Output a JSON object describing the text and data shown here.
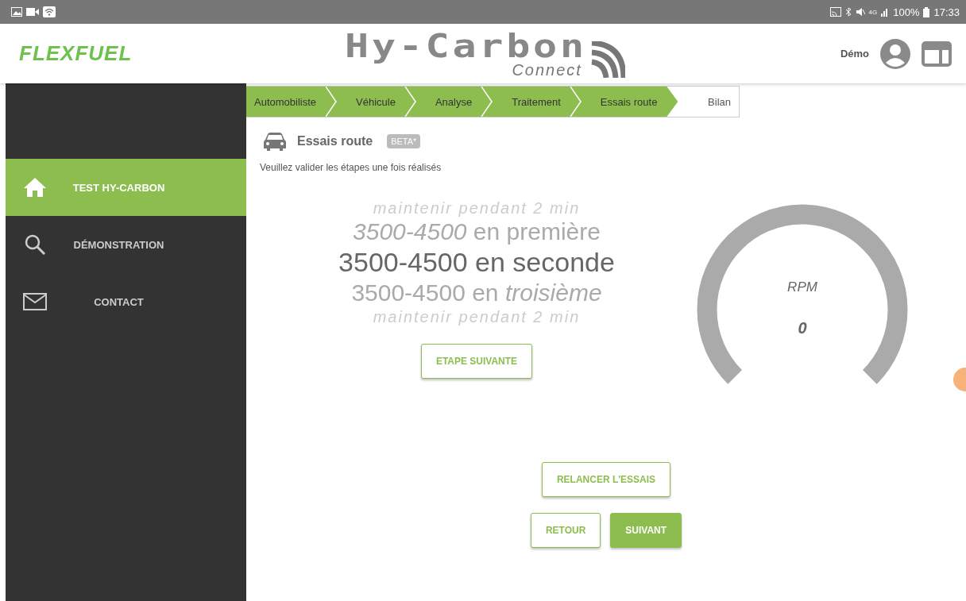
{
  "status_bar": {
    "network": "4G",
    "battery": "100%",
    "time": "17:33"
  },
  "header": {
    "logo": "FLEXFUEL",
    "app_title": "Hy-Carbon",
    "app_subtitle": "Connect",
    "user": "Démo"
  },
  "sidebar": {
    "items": [
      {
        "label": "TEST HY-CARBON",
        "selected": true
      },
      {
        "label": "DÉMONSTRATION",
        "selected": false
      },
      {
        "label": "CONTACT",
        "selected": false
      }
    ]
  },
  "steps": [
    {
      "label": "Automobiliste",
      "done": true
    },
    {
      "label": "Véhicule",
      "done": true
    },
    {
      "label": "Analyse",
      "done": true
    },
    {
      "label": "Traitement",
      "done": true
    },
    {
      "label": "Essais route",
      "done": true
    },
    {
      "label": "Bilan",
      "done": false
    }
  ],
  "section": {
    "title": "Essais route",
    "badge": "BETA*",
    "instruction": "Veuillez valider les étapes une fois réalisés"
  },
  "picker": [
    {
      "text": "maintenir pendant 2 min",
      "kind": "hint"
    },
    {
      "text": "*3500-4500* en première",
      "kind": "option"
    },
    {
      "text": "3500-4500 en seconde",
      "kind": "current"
    },
    {
      "text": "3500-4500 en *troisième*",
      "kind": "option"
    },
    {
      "text": "maintenir pendant 2 min",
      "kind": "hint"
    }
  ],
  "gauge": {
    "label": "RPM",
    "reading": "0"
  },
  "buttons": [
    {
      "label": "ETAPE SUIVANTE",
      "kind": "outline"
    },
    {
      "label": "RELANCER L'ESSAIS",
      "kind": "outline"
    },
    {
      "label": "RETOUR",
      "kind": "outline"
    },
    {
      "label": "SUIVANT",
      "kind": "filled"
    }
  ]
}
